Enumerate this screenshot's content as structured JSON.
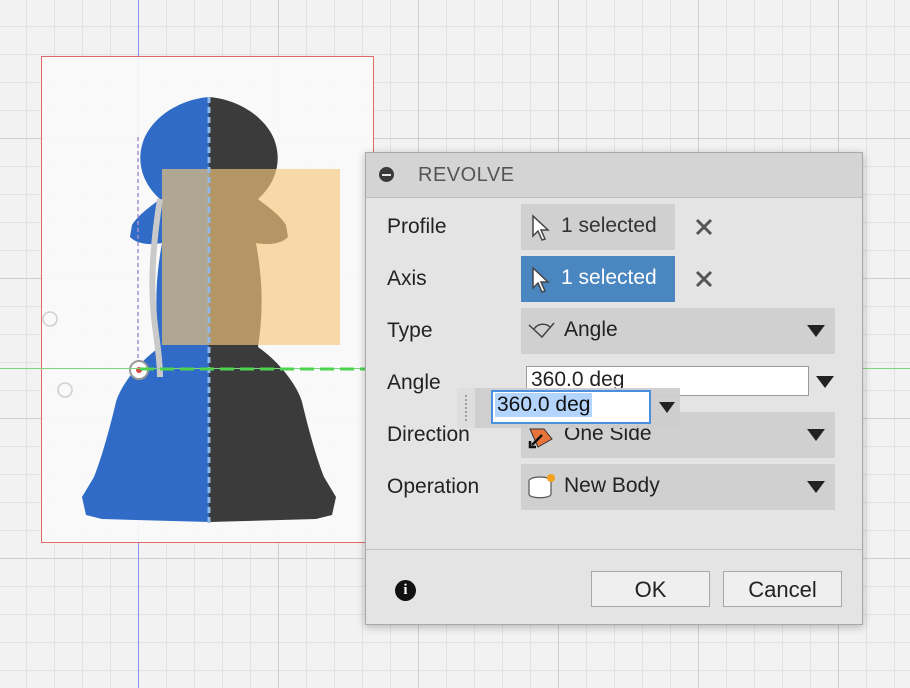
{
  "dialog": {
    "title": "REVOLVE",
    "rows": {
      "profile": {
        "label": "Profile",
        "value": "1 selected"
      },
      "axis": {
        "label": "Axis",
        "value": "1 selected"
      },
      "type": {
        "label": "Type",
        "value": "Angle"
      },
      "angle": {
        "label": "Angle",
        "value": "360.0 deg"
      },
      "direction": {
        "label": "Direction",
        "value": "One Side"
      },
      "operation": {
        "label": "Operation",
        "value": "New Body"
      }
    },
    "ok_label": "OK",
    "cancel_label": "Cancel"
  },
  "manipulator": {
    "value": "360.0 deg"
  },
  "colors": {
    "active_field": "#4a86c0",
    "pawn_blue": "#2f6bc7",
    "pawn_dark": "#3a3a3a",
    "profile_highlight": "#f5c77a"
  },
  "icons": [
    "collapse-icon",
    "cursor-icon",
    "close-icon",
    "angle-icon",
    "direction-icon",
    "new-body-icon",
    "info-icon",
    "chevron-down-icon"
  ]
}
